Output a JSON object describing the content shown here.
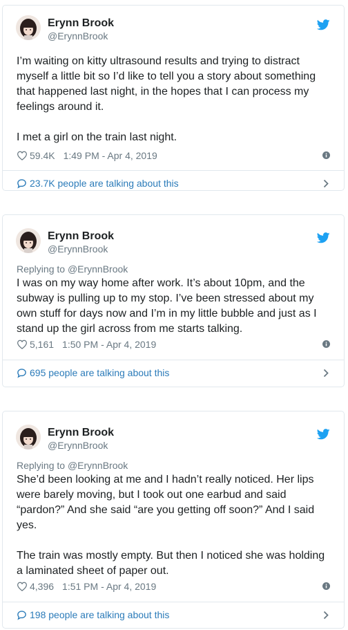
{
  "tweets": [
    {
      "author_name": "Erynn Brook",
      "author_handle": "@ErynnBrook",
      "reply_prefix": "",
      "reply_to": "",
      "text": "I’m waiting on kitty ultrasound results and trying to distract myself a little bit so I’d like to tell you a story about something that happened last night, in the hopes that I can process my feelings around it.\n\nI met a girl on the train last night.",
      "likes": "59.4K",
      "timestamp": "1:49 PM - Apr 4, 2019",
      "talking": "23.7K people are talking about this"
    },
    {
      "author_name": "Erynn Brook",
      "author_handle": "@ErynnBrook",
      "reply_prefix": "Replying to ",
      "reply_to": "@ErynnBrook",
      "text": "I was on my way home after work. It’s about 10pm, and the subway is pulling up to my stop. I’ve been stressed about my own stuff for days now and I’m in my little bubble and just as I stand up the girl across from me starts talking.",
      "likes": "5,161",
      "timestamp": "1:50 PM - Apr 4, 2019",
      "talking": "695 people are talking about this"
    },
    {
      "author_name": "Erynn Brook",
      "author_handle": "@ErynnBrook",
      "reply_prefix": "Replying to ",
      "reply_to": "@ErynnBrook",
      "text": "She’d been looking at me and I hadn’t really noticed. Her lips were barely moving, but I took out one earbud and said “pardon?” And she said “are you getting off soon?” And I said yes.\n\nThe train was mostly empty. But then I noticed she was holding a laminated sheet of paper out.",
      "likes": "4,396",
      "timestamp": "1:51 PM - Apr 4, 2019",
      "talking": "198 people are talking about this"
    }
  ],
  "colors": {
    "twitter_blue": "#1da1f2",
    "link_blue": "#2b7bb9",
    "meta_gray": "#697882",
    "border": "#e1e8ed"
  },
  "icons": [
    "twitter-bird-icon",
    "heart-icon",
    "info-icon",
    "chat-bubble-icon",
    "chevron-right-icon"
  ]
}
